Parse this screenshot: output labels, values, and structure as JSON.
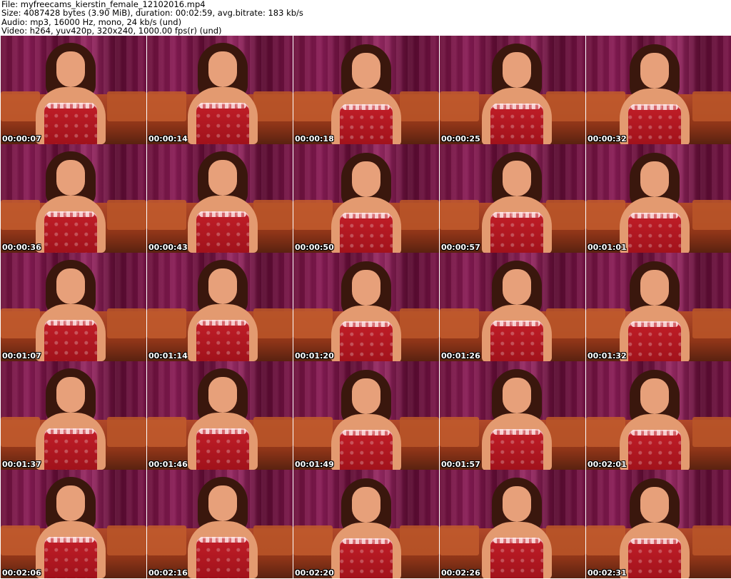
{
  "header": {
    "file_line": "File: myfreecams_kierstin_female_12102016.mp4",
    "size_line": "Size: 4087428 bytes (3.90 MiB), duration: 00:02:59, avg.bitrate: 183 kb/s",
    "audio_line": "Audio: mp3, 16000 Hz, mono, 24 kb/s (und)",
    "video_line": "Video: h264, yuv420p, 320x240, 1000.00 fps(r) (und)"
  },
  "thumbnails": [
    {
      "time": "00:00:07"
    },
    {
      "time": "00:00:14"
    },
    {
      "time": "00:00:18"
    },
    {
      "time": "00:00:25"
    },
    {
      "time": "00:00:32"
    },
    {
      "time": "00:00:36"
    },
    {
      "time": "00:00:43"
    },
    {
      "time": "00:00:50"
    },
    {
      "time": "00:00:57"
    },
    {
      "time": "00:01:01"
    },
    {
      "time": "00:01:07"
    },
    {
      "time": "00:01:14"
    },
    {
      "time": "00:01:20"
    },
    {
      "time": "00:01:26"
    },
    {
      "time": "00:01:32"
    },
    {
      "time": "00:01:37"
    },
    {
      "time": "00:01:46"
    },
    {
      "time": "00:01:49"
    },
    {
      "time": "00:01:57"
    },
    {
      "time": "00:02:01"
    },
    {
      "time": "00:02:06"
    },
    {
      "time": "00:02:16"
    },
    {
      "time": "00:02:20"
    },
    {
      "time": "00:02:26"
    },
    {
      "time": "00:02:31"
    }
  ]
}
